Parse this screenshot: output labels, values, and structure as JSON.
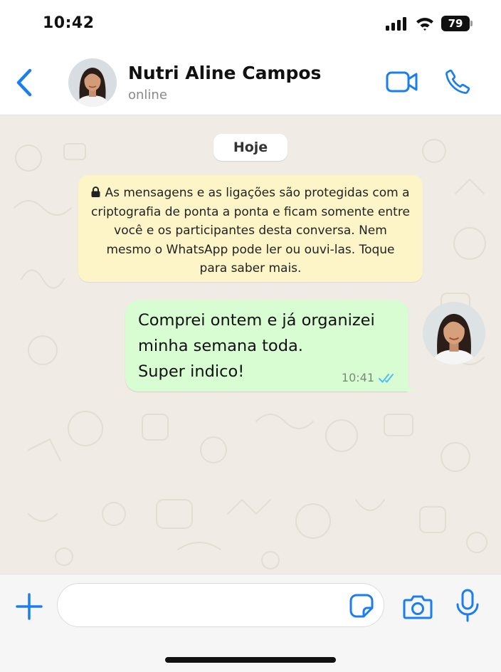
{
  "status_bar": {
    "time": "10:42",
    "battery": "79",
    "icons": [
      "signal-icon",
      "wifi-icon",
      "battery-icon"
    ]
  },
  "header": {
    "contact_name": "Nutri Aline Campos",
    "contact_status": "online",
    "icons": [
      "back-chevron-icon",
      "video-camera-icon",
      "phone-icon"
    ]
  },
  "chat": {
    "date_label": "Hoje",
    "encryption_notice": "As mensagens e as ligações são protegidas com a criptografia de ponta a ponta e ficam somente entre você e os participantes desta conversa. Nem mesmo o WhatsApp pode ler ou ouvi-las. Toque para saber mais.",
    "messages": [
      {
        "direction": "outgoing",
        "text": "Comprei ontem e já organizei\nminha semana toda.\nSuper indico!",
        "time": "10:41",
        "status": "read"
      }
    ]
  },
  "input_bar": {
    "placeholder": "",
    "value": "",
    "icons": [
      "plus-icon",
      "sticker-icon",
      "camera-icon",
      "microphone-icon"
    ]
  },
  "colors": {
    "accent": "#1a7ef0",
    "outgoing_bubble": "#d9fdd3",
    "notice_background": "#fdf4c7",
    "wallpaper": "#f0ece5",
    "read_ticks": "#53bdeb"
  }
}
